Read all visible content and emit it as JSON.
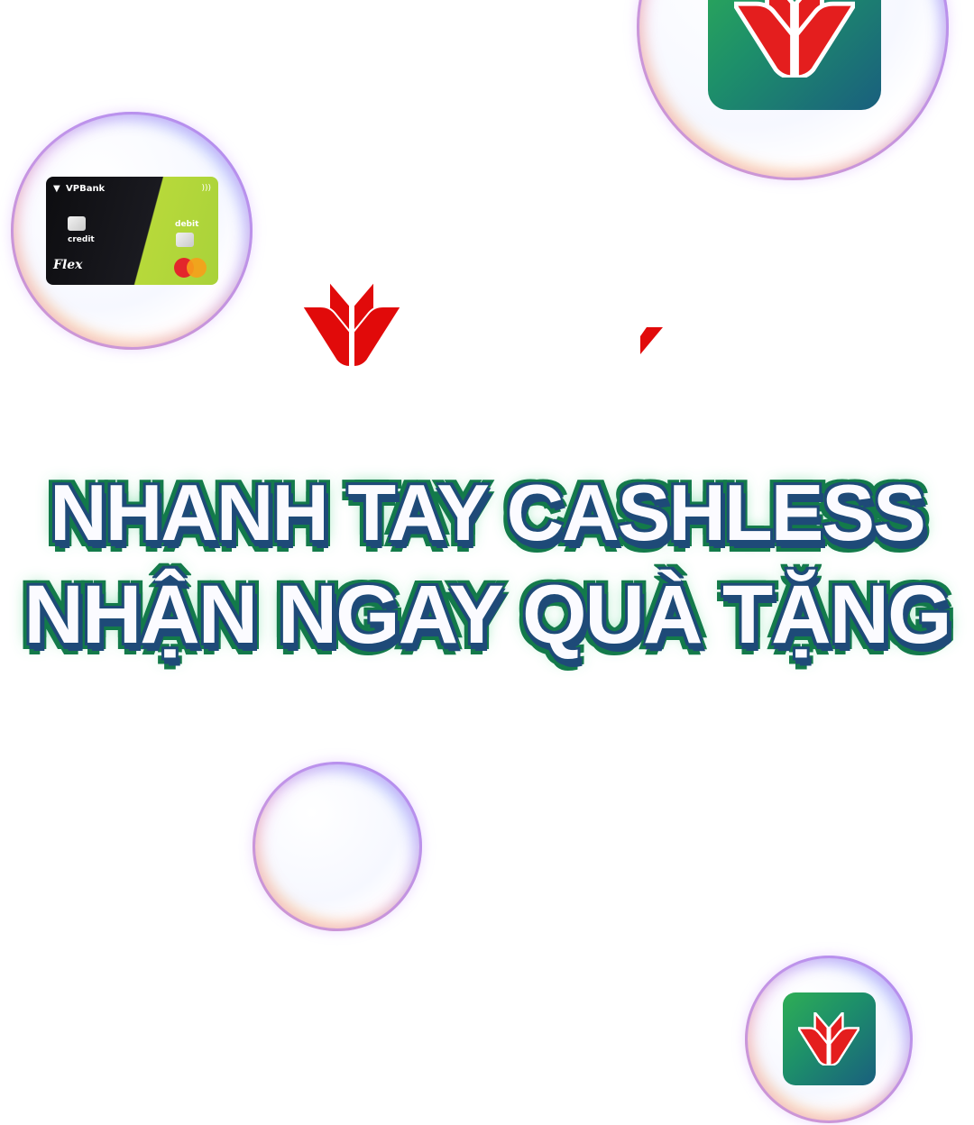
{
  "headline": {
    "line1": "NHANH TAY CASHLESS",
    "line2": "NHẬN NGAY QUÀ TẶNG"
  },
  "card": {
    "brand": "VPBank",
    "credit_label": "credit",
    "debit_label": "debit",
    "product": "Flex"
  },
  "colors": {
    "brand_red": "#e10a0a",
    "navy_outline": "#1e4a78",
    "green_glow": "#137a4a"
  }
}
